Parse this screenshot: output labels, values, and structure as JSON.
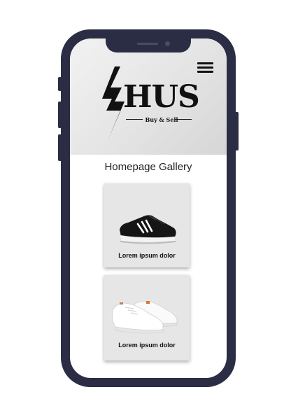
{
  "app": {
    "logo_text": "HUS",
    "logo_tagline": "Buy & Sell",
    "menu_icon": "hamburger-menu-icon"
  },
  "gallery": {
    "title": "Homepage Gallery",
    "items": [
      {
        "caption": "Lorem ipsum dolor",
        "image": "black-sneaker"
      },
      {
        "caption": "Lorem ipsum dolor",
        "image": "white-sneaker"
      }
    ]
  },
  "colors": {
    "device_frame": "#2b2d45",
    "header_bg": "#e4e4e4",
    "card_bg": "#e6e6e6"
  }
}
